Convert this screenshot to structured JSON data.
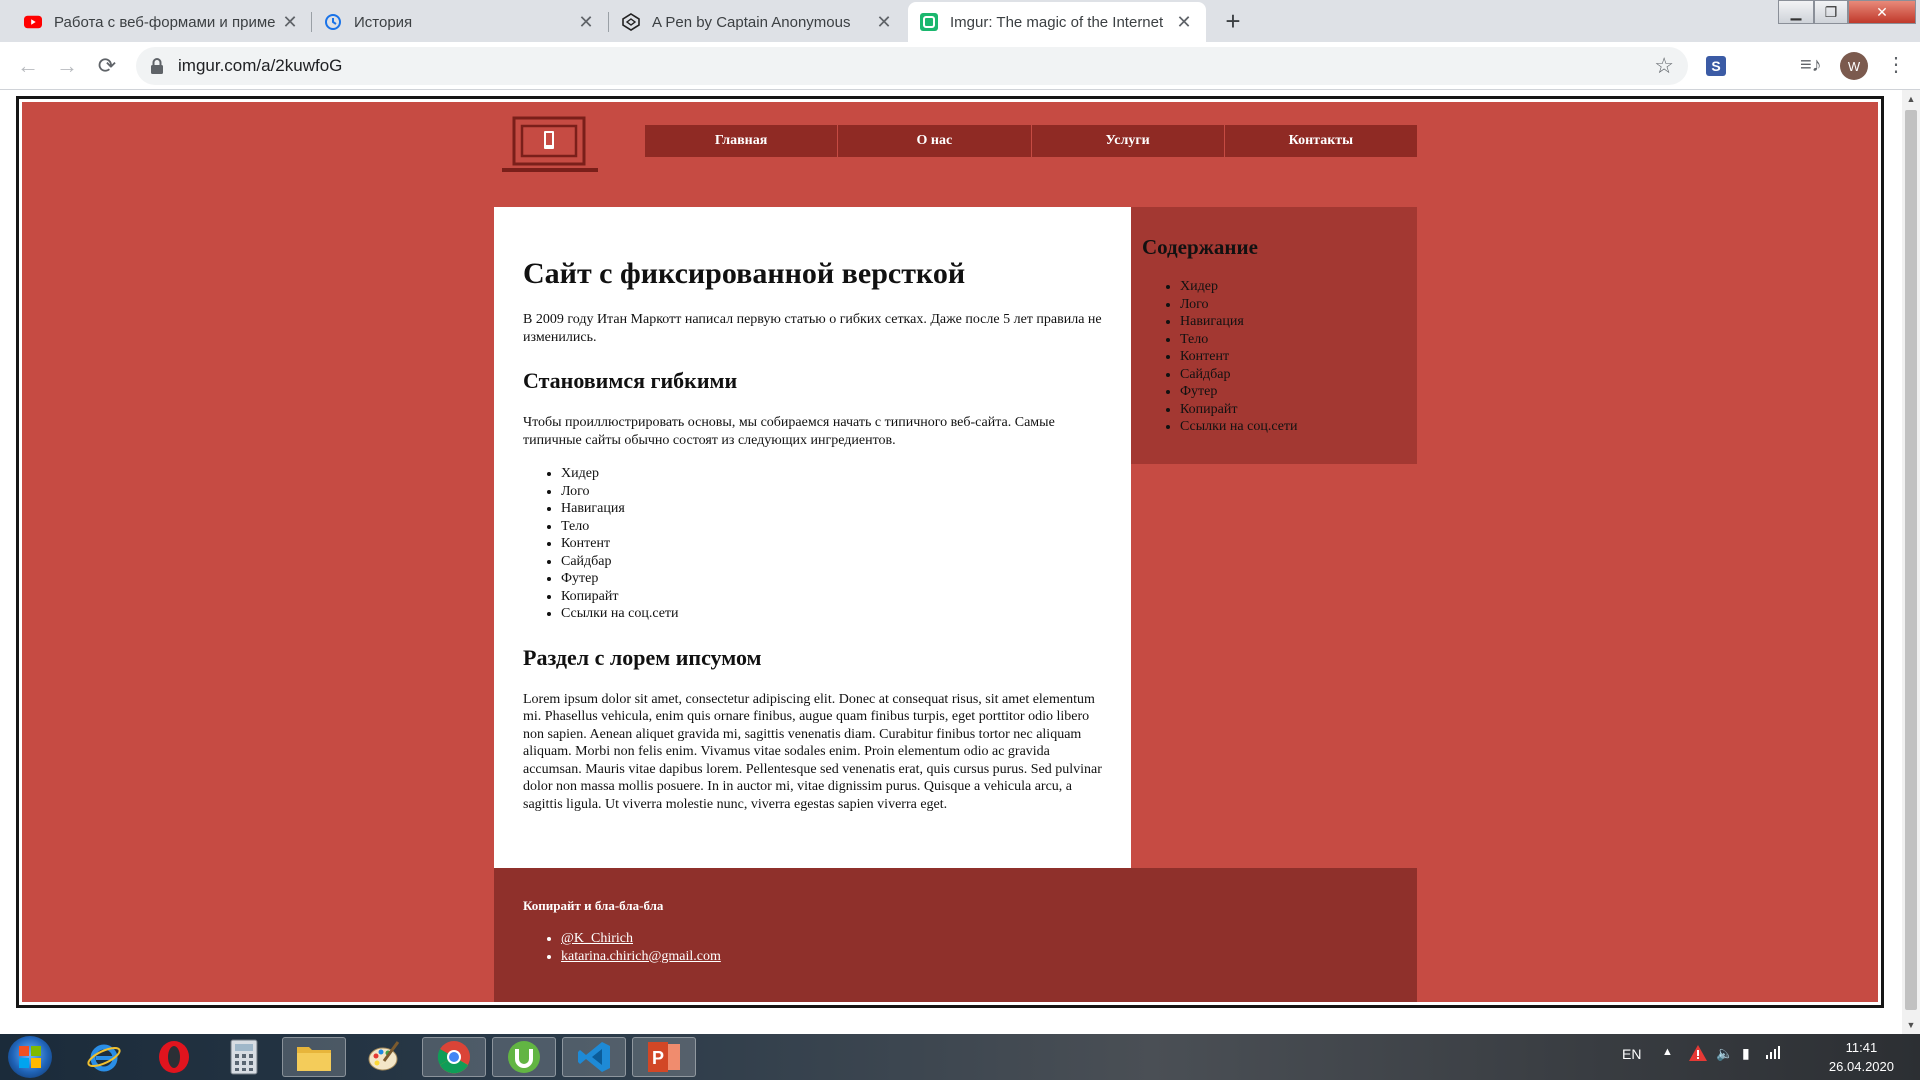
{
  "browser": {
    "tabs": [
      {
        "title": "Работа с веб-формами и приме",
        "icon": "youtube-icon",
        "active": false
      },
      {
        "title": "История",
        "icon": "history-icon",
        "active": false
      },
      {
        "title": "A Pen by Captain Anonymous",
        "icon": "codepen-icon",
        "active": false
      },
      {
        "title": "Imgur: The magic of the Internet",
        "icon": "imgur-icon",
        "active": true
      }
    ],
    "url": "imgur.com/a/2kuwfoG",
    "profile_initial": "W",
    "extension_letter": "S"
  },
  "site": {
    "nav": [
      "Главная",
      "О нас",
      "Услуги",
      "Контакты"
    ],
    "content": {
      "h1": "Сайт с фиксированной версткой",
      "p1": "В 2009 году Итан Маркотт написал первую статью о гибких сетках. Даже после 5 лет правила не изменились.",
      "h2a": "Становимся гибкими",
      "p2": "Чтобы проиллюстрировать основы, мы собираемся начать с типичного веб-сайта. Самые типичные сайты обычно состоят из следующих ингредиентов.",
      "list": [
        "Хидер",
        "Лого",
        "Навигация",
        "Тело",
        "Контент",
        "Сайдбар",
        "Футер",
        "Копирайт",
        "Ссылки на соц.сети"
      ],
      "h2b": "Раздел с лорем ипсумом",
      "p3": "Lorem ipsum dolor sit amet, consectetur adipiscing elit. Donec at consequat risus, sit amet elementum mi. Phasellus vehicula, enim quis ornare finibus, augue quam finibus turpis, eget porttitor odio libero non sapien. Aenean aliquet gravida mi, sagittis venenatis diam. Curabitur finibus tortor nec aliquam aliquam. Morbi non felis enim. Vivamus vitae sodales enim. Proin elementum odio ac gravida accumsan. Mauris vitae dapibus lorem. Pellentesque sed venenatis erat, quis cursus purus. Sed pulvinar dolor non massa mollis posuere. In in auctor mi, vitae dignissim purus. Quisque a vehicula arcu, a sagittis ligula. Ut viverra molestie nunc, viverra egestas sapien viverra eget."
    },
    "sidebar": {
      "title": "Содержание",
      "list": [
        "Хидер",
        "Лого",
        "Навигация",
        "Тело",
        "Контент",
        "Сайдбар",
        "Футер",
        "Копирайт",
        "Ссылки на соц.сети"
      ]
    },
    "footer": {
      "copyright": "Копирайт и бла-бла-бла",
      "links": [
        "@K_Chirich",
        "katarina.chirich@gmail.com"
      ]
    },
    "colors": {
      "background": "#c64b43",
      "nav": "#8f2a24",
      "sidebar": "#a33832",
      "footer": "#8f302b"
    }
  },
  "taskbar": {
    "apps": [
      "internet-explorer",
      "opera",
      "calculator",
      "file-explorer",
      "paint",
      "chrome",
      "utorrent",
      "vscode",
      "powerpoint"
    ],
    "language": "EN",
    "time": "11:41",
    "date": "26.04.2020"
  }
}
